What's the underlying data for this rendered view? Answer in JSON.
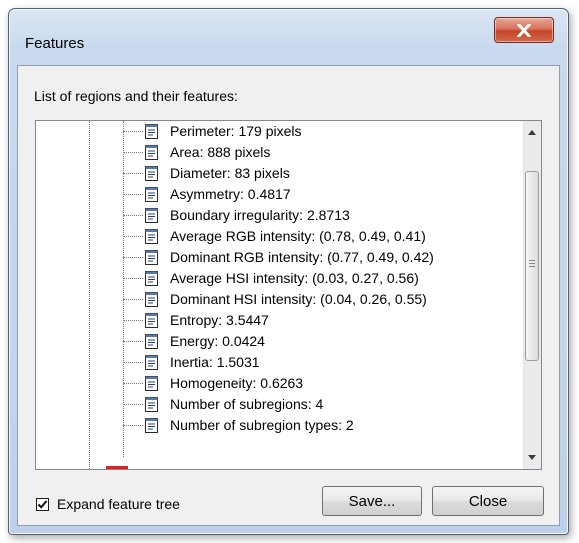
{
  "window": {
    "title": "Features"
  },
  "dialog": {
    "caption": "List of regions and their features:"
  },
  "features": [
    {
      "label": "Perimeter: 179 pixels"
    },
    {
      "label": "Area: 888 pixels"
    },
    {
      "label": "Diameter: 83 pixels"
    },
    {
      "label": "Asymmetry: 0.4817"
    },
    {
      "label": "Boundary irregularity: 2.8713"
    },
    {
      "label": "Average RGB intensity: (0.78, 0.49, 0.41)"
    },
    {
      "label": "Dominant RGB intensity: (0.77, 0.49, 0.42)"
    },
    {
      "label": "Average HSI intensity: (0.03, 0.27, 0.56)"
    },
    {
      "label": "Dominant HSI intensity: (0.04, 0.26, 0.55)"
    },
    {
      "label": "Entropy: 3.5447"
    },
    {
      "label": "Energy: 0.0424"
    },
    {
      "label": "Inertia: 1.5031"
    },
    {
      "label": "Homogeneity: 0.6263"
    },
    {
      "label": "Number of subregions: 4"
    },
    {
      "label": "Number of subregion types: 2"
    }
  ],
  "options": {
    "expand_label": "Expand feature tree",
    "expand_checked": true
  },
  "buttons": {
    "save_label": "Save...",
    "close_label": "Close"
  },
  "icons": {
    "close": "close-icon",
    "item": "document-icon",
    "check": "checkmark-icon"
  },
  "colors": {
    "close_button": "#c4452a",
    "selection_marker": "#e0201f"
  }
}
